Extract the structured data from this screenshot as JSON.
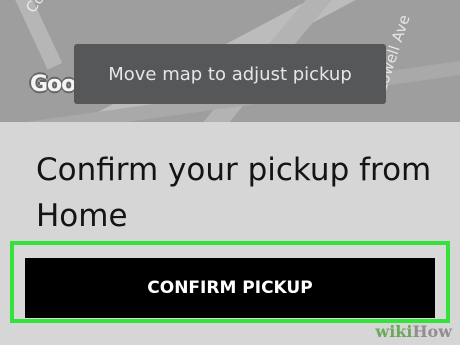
{
  "map": {
    "street_top": "Co",
    "street_right": "Lowell Ave",
    "logo_text": "Google"
  },
  "tooltip": {
    "text": "Move map to adjust pickup"
  },
  "sheet": {
    "heading": "Confirm your pickup from Home",
    "confirm_button_label": "CONFIRM PICKUP"
  },
  "watermark": {
    "wiki": "wiki",
    "how": "How"
  },
  "colors": {
    "highlight_border": "#33e23a",
    "button_bg": "#000000",
    "tooltip_bg": "#555758"
  }
}
